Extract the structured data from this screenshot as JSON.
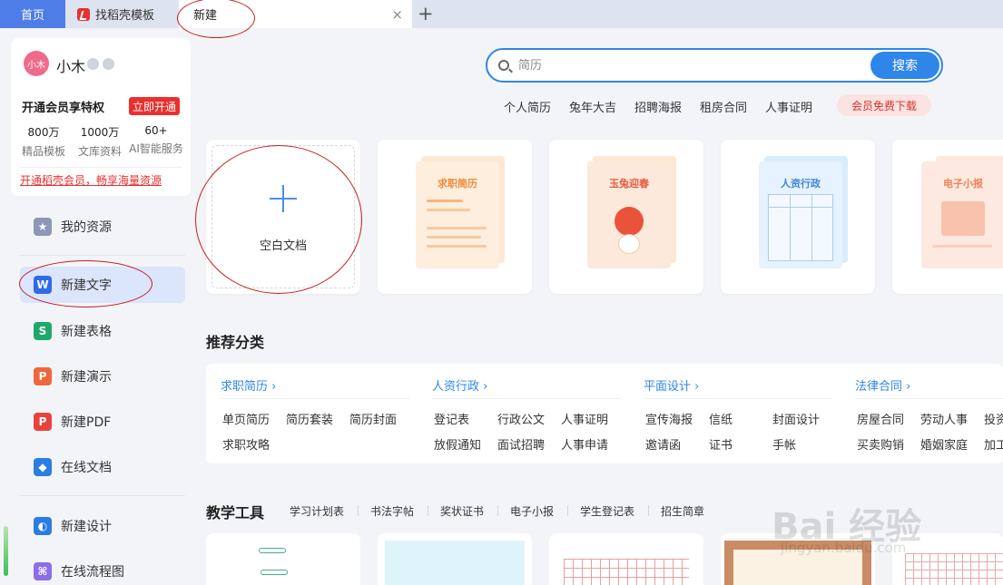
{
  "tabs": {
    "home": "首页",
    "templates": "找稻壳模板",
    "new": "新建",
    "close_glyph": "×",
    "add_glyph": "+"
  },
  "user": {
    "avatar_text": "小木",
    "name": "小木",
    "vip_label": "开通会员享特权",
    "vip_button": "立即开通",
    "stats": [
      {
        "num": "800万",
        "label": "精品模板"
      },
      {
        "num": "1000万",
        "label": "文库资料"
      },
      {
        "num": "60+",
        "label": "AI智能服务"
      }
    ],
    "promo_link": "开通稻壳会员，畅享海量资源"
  },
  "sidebar": {
    "items": [
      {
        "label": "我的资源",
        "icon": "star-icon",
        "color": "#8d97b6"
      },
      {
        "label": "新建文字",
        "icon": "writer-icon",
        "color": "#2e6be6"
      },
      {
        "label": "新建表格",
        "icon": "spreadsheet-icon",
        "color": "#1fa86b"
      },
      {
        "label": "新建演示",
        "icon": "presentation-icon",
        "color": "#f0673d"
      },
      {
        "label": "新建PDF",
        "icon": "pdf-icon",
        "color": "#e8423e"
      },
      {
        "label": "在线文档",
        "icon": "cloud-doc-icon",
        "color": "#2a7de1"
      },
      {
        "label": "新建设计",
        "icon": "design-icon",
        "color": "#2a7de1"
      },
      {
        "label": "在线流程图",
        "icon": "flowchart-icon",
        "color": "#8d6ee8"
      }
    ]
  },
  "search": {
    "placeholder": "简历",
    "button": "搜索",
    "hot_tags": [
      "个人简历",
      "兔年大吉",
      "招聘海报",
      "租房合同",
      "人事证明"
    ],
    "free_download": "会员免费下载"
  },
  "templates": {
    "blank": "空白文档",
    "cards": [
      {
        "title": "求职简历",
        "color": "#f08a3c"
      },
      {
        "title": "玉兔迎春",
        "color": "#e85a3a"
      },
      {
        "title": "人资行政",
        "color": "#3d86d9"
      },
      {
        "title": "电子小报",
        "color": "#f0825a"
      }
    ]
  },
  "recommended": {
    "title": "推荐分类",
    "groups": [
      {
        "head": "求职简历",
        "items": [
          "单页简历",
          "简历套装",
          "简历封面",
          "求职攻略"
        ]
      },
      {
        "head": "人资行政",
        "items": [
          "登记表",
          "行政公文",
          "人事证明",
          "放假通知",
          "面试招聘",
          "人事申请"
        ]
      },
      {
        "head": "平面设计",
        "items": [
          "宣传海报",
          "信纸",
          "封面设计",
          "邀请函",
          "证书",
          "手帐"
        ]
      },
      {
        "head": "法律合同",
        "items": [
          "房屋合同",
          "劳动人事",
          "投资",
          "买卖购销",
          "婚姻家庭",
          "加工"
        ]
      }
    ]
  },
  "tools": {
    "title": "教学工具",
    "tabs": [
      "学习计划表",
      "书法字帖",
      "奖状证书",
      "电子小报",
      "学生登记表",
      "招生简章"
    ]
  },
  "watermark": {
    "main": "Bai 经验",
    "sub": "jingyan.baidu.com"
  }
}
